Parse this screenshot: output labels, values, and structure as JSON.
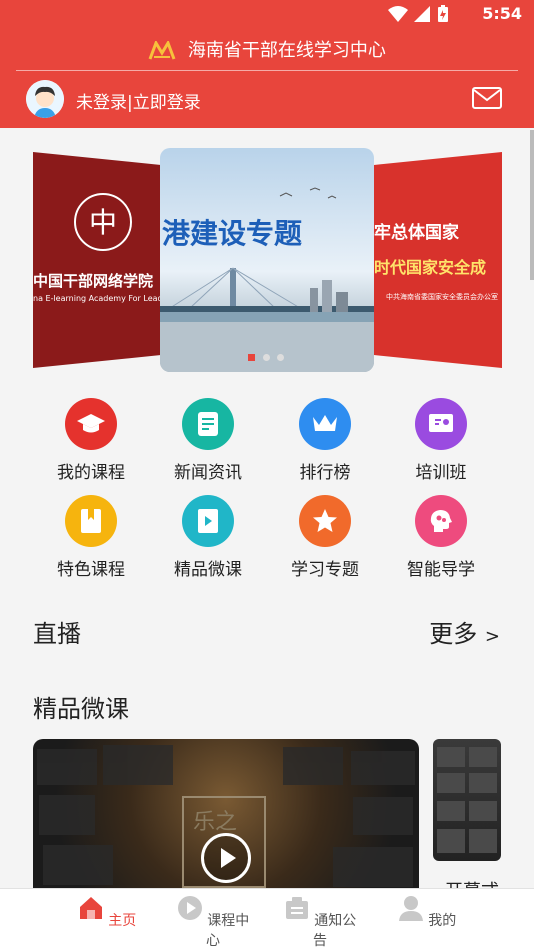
{
  "status": {
    "time": "5:54"
  },
  "app": {
    "title": "海南省干部在线学习中心"
  },
  "user": {
    "login_text": "未登录|立即登录"
  },
  "carousel": {
    "left_slide_text": "中国干部网络学院",
    "left_slide_sub": "na E-learning Academy For Leadership",
    "center_slide_text": "港建设专题",
    "right_slide_text": "牢总体国家",
    "right_slide_text2": "时代国家安全成",
    "right_slide_sub": "中共海南省委国家安全委员会办公室",
    "dots_total": 3,
    "active_dot": 1
  },
  "grid": [
    {
      "label": "我的课程",
      "icon": "graduation-cap-icon",
      "color": "#e5322d"
    },
    {
      "label": "新闻资讯",
      "icon": "document-icon",
      "color": "#17b6a2"
    },
    {
      "label": "排行榜",
      "icon": "crown-icon",
      "color": "#2e8df0"
    },
    {
      "label": "培训班",
      "icon": "training-icon",
      "color": "#9a4be0"
    },
    {
      "label": "特色课程",
      "icon": "bookmark-book-icon",
      "color": "#f6b40e"
    },
    {
      "label": "精品微课",
      "icon": "play-book-icon",
      "color": "#20b6c8"
    },
    {
      "label": "学习专题",
      "icon": "star-icon",
      "color": "#f16a2b"
    },
    {
      "label": "智能导学",
      "icon": "brain-icon",
      "color": "#ee4b7e"
    }
  ],
  "live": {
    "title": "直播",
    "more": "更多",
    "more_arrow": ">"
  },
  "micro": {
    "title": "精品微课",
    "video2_label": "开幕式"
  },
  "tabs": [
    {
      "label": "主页",
      "icon": "home-icon",
      "active": true
    },
    {
      "label": "课程中心",
      "icon": "play-circle-icon",
      "active": false
    },
    {
      "label": "通知公告",
      "icon": "notice-icon",
      "active": false
    },
    {
      "label": "我的",
      "icon": "user-icon",
      "active": false
    }
  ],
  "colors": {
    "brand": "#e8453c"
  }
}
